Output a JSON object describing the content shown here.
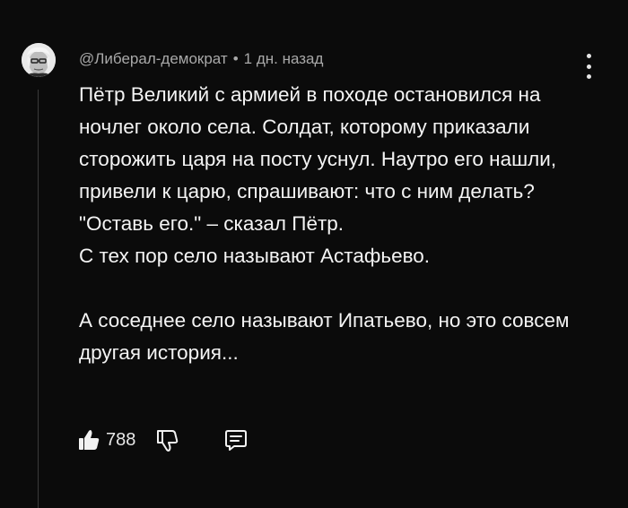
{
  "comment": {
    "author": "@Либерал-демократ",
    "separator": "•",
    "time": "1 дн. назад",
    "paragraphs": [
      "Пётр Великий с армией в походе остановился на ночлег около села. Солдат, которому приказали сторожить царя на посту уснул.  Наутро его нашли, привели к царю, спрашивают: что с ним делать?\n\"Оставь его.\" – сказал Пётр.\nС тех пор село называют Астафьево.",
      "А соседнее село называют Ипатьево, но это совсем другая история..."
    ],
    "likes": "788"
  },
  "icons": {
    "more": "more-vertical-icon",
    "like": "thumbs-up-filled-icon",
    "dislike": "thumbs-down-outline-icon",
    "reply": "comment-reply-icon"
  },
  "colors": {
    "background": "#0b0b0b",
    "text": "#f4f4f4",
    "meta": "#a9a9a9"
  }
}
